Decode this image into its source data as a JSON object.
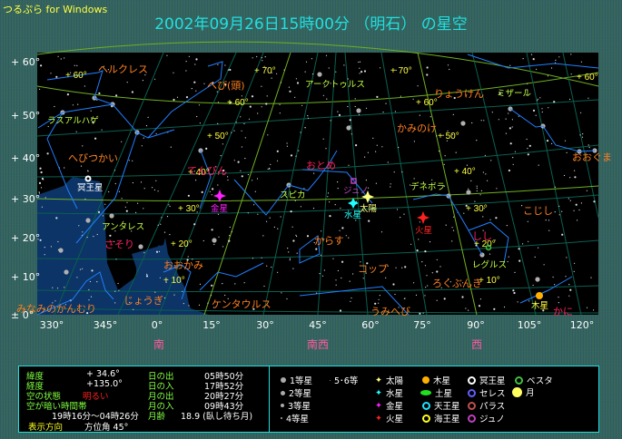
{
  "app_title": "つるぷら for Windows",
  "title": "2002年09月26日15時00分 （明石） の星空",
  "altitude_labels": [
    "+ 60°",
    "+ 50°",
    "+ 40°",
    "+ 30°",
    "+ 20°",
    "+ 10°",
    "± 0°"
  ],
  "azimuth_labels": [
    "330°",
    "345°",
    "0°",
    "15°",
    "30°",
    "45°",
    "60°",
    "75°",
    "90°",
    "105°",
    "120°"
  ],
  "directions": [
    "南",
    "南西",
    "西"
  ],
  "grid_labels": [
    "+ 60°",
    "+ 70°",
    "+ 60°",
    "+ 50°",
    "+ 40°",
    "+ 30°",
    "+ 20°",
    "+ 10°",
    "+ 70°",
    "+ 60°",
    "+ 50°",
    "+ 40°",
    "+ 30°",
    "+ 20°",
    "+ 10°",
    "+ 60°"
  ],
  "constellations": [
    "ヘルクレス",
    "へび(頭)",
    "へびつかい",
    "てんびん",
    "おとめ",
    "りょうけん",
    "かみのけ",
    "おおぐま",
    "こじし",
    "しし",
    "からす",
    "コップ",
    "ろくぶんき",
    "うみへび",
    "かに",
    "さそり",
    "おおかみ",
    "じょうぎ",
    "ケンタウルス",
    "みなみのかんむり"
  ],
  "star_names": [
    "アークトゥルス",
    "ミザール",
    "デネボラ",
    "スピカ",
    "アンタレス",
    "レグルス",
    "ラスアルハゲ"
  ],
  "planets": [
    "冥王星",
    "金星",
    "水星",
    "太陽",
    "火星",
    "木星",
    "ジュノ"
  ],
  "info": {
    "latitude_label": "緯度",
    "latitude": "+   34.6°",
    "longitude_label": "経度",
    "longitude": "+135.0°",
    "sky_state_label": "空の状態",
    "sky_state": "明るい",
    "dark_period_label": "空が暗い時間帯",
    "dark_period": "19時16分～04時26分",
    "direction_label": "表示方向",
    "direction": "方位角  45°",
    "sunrise_label": "日の出",
    "sunrise": "05時50分",
    "sunset_label": "日の入",
    "sunset": "17時52分",
    "moonrise_label": "月の出",
    "moonrise": "20時27分",
    "moonset_label": "月の入",
    "moonset": "09時43分",
    "moon_age_label": "月齢",
    "moon_age": "18.9 (臥し待ち月)"
  },
  "legend": {
    "mag1": "1等星",
    "mag2": "2等星",
    "mag3": "3等星",
    "mag4": "4等星",
    "mag56": "5･6等",
    "sun": "太陽",
    "mercury": "水星",
    "venus": "金星",
    "mars": "火星",
    "jupiter": "木星",
    "saturn": "土星",
    "uranus": "天王星",
    "neptune": "海王星",
    "pluto": "冥王星",
    "ceres": "セレス",
    "pallas": "パラス",
    "juno": "ジュノ",
    "vesta": "ベスタ",
    "moon": "月"
  },
  "colors": {
    "title": "#20e0e0",
    "constellation": "#ff8020",
    "star_name": "#c0ff40",
    "grid_label": "#ffff40",
    "line": "#2080ff"
  }
}
